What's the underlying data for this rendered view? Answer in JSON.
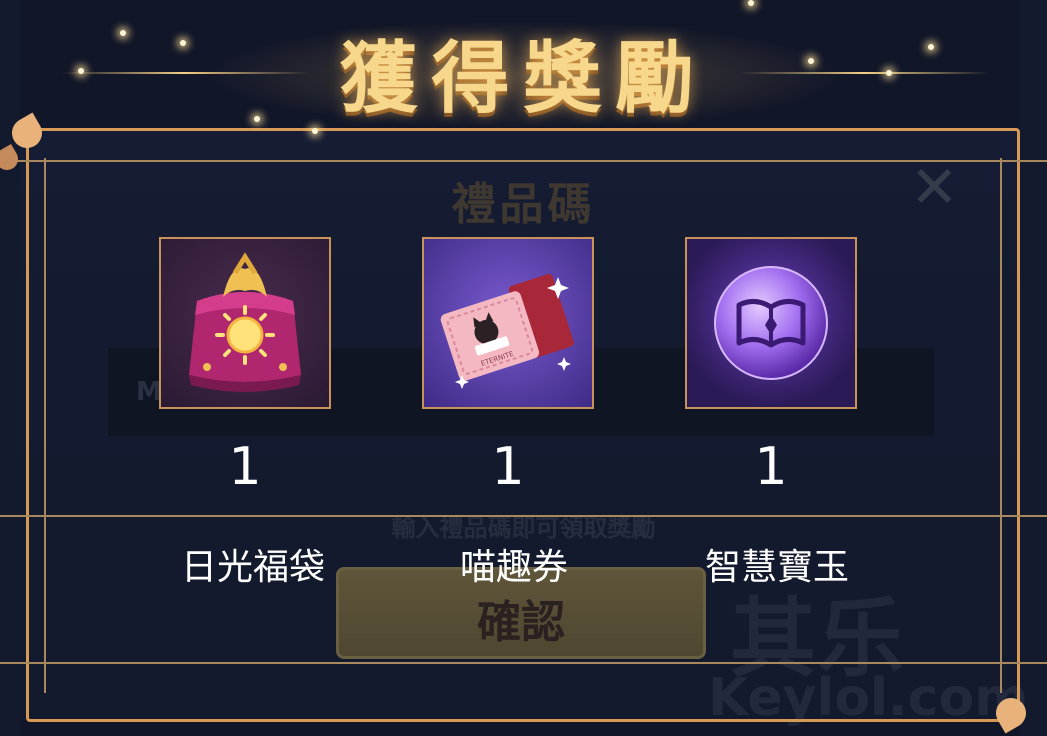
{
  "header": {
    "title": "獲得獎勵"
  },
  "background_dialog": {
    "title": "禮品碼",
    "close_icon": "close-icon",
    "input_value_fragment": "M4",
    "hint": "輸入禮品碼即可領取獎勵",
    "confirm_label": "確認"
  },
  "rewards": {
    "items": [
      {
        "name": "日光福袋",
        "quantity": "1",
        "icon": "sun-lucky-bag-icon"
      },
      {
        "name": "喵趣券",
        "quantity": "1",
        "icon": "cat-ticket-icon"
      },
      {
        "name": "智慧寶玉",
        "quantity": "1",
        "icon": "wisdom-orb-icon"
      }
    ]
  },
  "watermark": {
    "line1": "其乐",
    "line2": "Keylol.com"
  },
  "colors": {
    "frame": "#d69a56",
    "title": "#f6d78b",
    "background": "#141a2e"
  }
}
